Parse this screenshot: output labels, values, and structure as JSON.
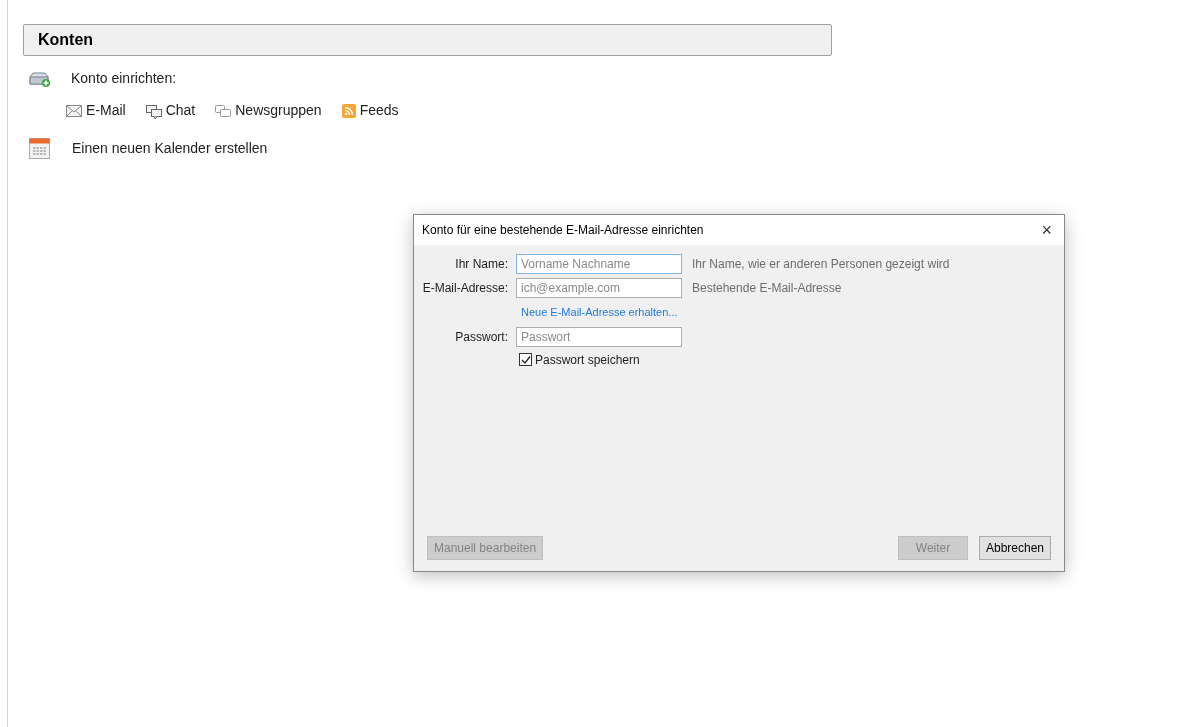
{
  "header": {
    "title": "Konten"
  },
  "setup": {
    "label": "Konto einrichten:",
    "links": [
      {
        "kind": "email",
        "label": "E-Mail"
      },
      {
        "kind": "chat",
        "label": "Chat"
      },
      {
        "kind": "news",
        "label": "Newsgruppen"
      },
      {
        "kind": "feed",
        "label": "Feeds"
      }
    ]
  },
  "calendar": {
    "label": "Einen neuen Kalender erstellen"
  },
  "dialog": {
    "title": "Konto für eine bestehende E-Mail-Adresse einrichten",
    "close": "×",
    "name": {
      "label": "Ihr Name:",
      "placeholder": "Vorname Nachname",
      "hint": "Ihr Name, wie er anderen Personen gezeigt wird"
    },
    "email": {
      "label": "E-Mail-Adresse:",
      "placeholder": "ich@example.com",
      "hint": "Bestehende E-Mail-Adresse"
    },
    "new_address_link": "Neue E-Mail-Adresse erhalten...",
    "password": {
      "label": "Passwort:",
      "placeholder": "Passwort"
    },
    "remember": {
      "label": "Passwort speichern",
      "checked": true
    },
    "buttons": [
      {
        "label": "Manuell bearbeiten",
        "disabled": true
      },
      {
        "label": "Weiter",
        "disabled": true
      },
      {
        "label": "Abbrechen",
        "disabled": false
      }
    ]
  }
}
